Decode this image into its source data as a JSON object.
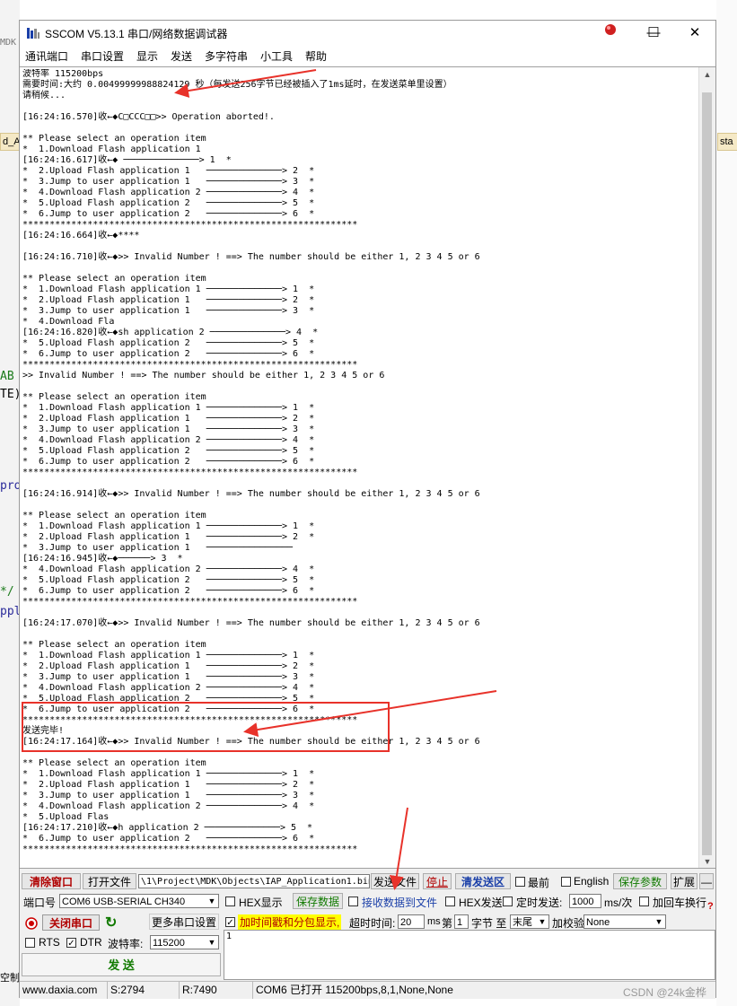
{
  "background": {
    "frag_mdk": "MDK",
    "frag_ab": "AB",
    "frag_te": "TE)",
    "frag_pro": "pro",
    "frag_comment": "*/",
    "frag_pl": "ppl",
    "frag_ctrl": "空制",
    "tab_left": "d_A",
    "tab_right": "sta"
  },
  "window": {
    "title": "SSCOM V5.13.1 串口/网络数据调试器",
    "minimize": "—",
    "maximize": "☐",
    "close": "✕"
  },
  "menu": [
    "通讯端口",
    "串口设置",
    "显示",
    "发送",
    "多字符串",
    "小工具",
    "帮助"
  ],
  "receive_lines": [
    "波特率 115200bps",
    "需要时间:大约 0.00499999988824129 秒（每发送256字节已经被插入了1ms延时，在发送菜单里设置）",
    "请稍候...",
    "",
    "[16:24:16.570]收←◆C□CCC□□>> Operation aborted!.",
    "",
    "** Please select an operation item",
    "*  1.Download Flash application 1",
    "[16:24:16.617]收←◆ ──────────────> 1  *",
    "*  2.Upload Flash application 1   ──────────────> 2  *",
    "*  3.Jump to user application 1   ──────────────> 3  *",
    "*  4.Download Flash application 2 ──────────────> 4  *",
    "*  5.Upload Flash application 2   ──────────────> 5  *",
    "*  6.Jump to user application 2   ──────────────> 6  *",
    "**************************************************************",
    "[16:24:16.664]收←◆****",
    "",
    "[16:24:16.710]收←◆>> Invalid Number ! ==> The number should be either 1, 2 3 4 5 or 6",
    "",
    "** Please select an operation item",
    "*  1.Download Flash application 1 ──────────────> 1  *",
    "*  2.Upload Flash application 1   ──────────────> 2  *",
    "*  3.Jump to user application 1   ──────────────> 3  *",
    "*  4.Download Fla",
    "[16:24:16.820]收←◆sh application 2 ──────────────> 4  *",
    "*  5.Upload Flash application 2   ──────────────> 5  *",
    "*  6.Jump to user application 2   ──────────────> 6  *",
    "**************************************************************",
    ">> Invalid Number ! ==> The number should be either 1, 2 3 4 5 or 6",
    "",
    "** Please select an operation item",
    "*  1.Download Flash application 1 ──────────────> 1  *",
    "*  2.Upload Flash application 1   ──────────────> 2  *",
    "*  3.Jump to user application 1   ──────────────> 3  *",
    "*  4.Download Flash application 2 ──────────────> 4  *",
    "*  5.Upload Flash application 2   ──────────────> 5  *",
    "*  6.Jump to user application 2   ──────────────> 6  *",
    "**************************************************************",
    "",
    "[16:24:16.914]收←◆>> Invalid Number ! ==> The number should be either 1, 2 3 4 5 or 6",
    "",
    "** Please select an operation item",
    "*  1.Download Flash application 1 ──────────────> 1  *",
    "*  2.Upload Flash application 1   ──────────────> 2  *",
    "*  3.Jump to user application 1   ────────────────",
    "[16:24:16.945]收←◆──────> 3  *",
    "*  4.Download Flash application 2 ──────────────> 4  *",
    "*  5.Upload Flash application 2   ──────────────> 5  *",
    "*  6.Jump to user application 2   ──────────────> 6  *",
    "**************************************************************",
    "",
    "[16:24:17.070]收←◆>> Invalid Number ! ==> The number should be either 1, 2 3 4 5 or 6",
    "",
    "** Please select an operation item",
    "*  1.Download Flash application 1 ──────────────> 1  *",
    "*  2.Upload Flash application 1   ──────────────> 2  *",
    "*  3.Jump to user application 1   ──────────────> 3  *",
    "*  4.Download Flash application 2 ──────────────> 4  *",
    "*  5.Upload Flash application 2   ──────────────> 5  *",
    "*  6.Jump to user application 2   ──────────────> 6  *",
    "**************************************************************",
    "发送完毕!",
    "[16:24:17.164]收←◆>> Invalid Number ! ==> The number should be either 1, 2 3 4 5 or 6",
    "",
    "** Please select an operation item",
    "*  1.Download Flash application 1 ──────────────> 1  *",
    "*  2.Upload Flash application 1   ──────────────> 2  *",
    "*  3.Jump to user application 1   ──────────────> 3  *",
    "*  4.Download Flash application 2 ──────────────> 4  *",
    "*  5.Upload Flas",
    "[16:24:17.210]收←◆h application 2 ──────────────> 5  *",
    "*  6.Jump to user application 2   ──────────────> 6  *",
    "**************************************************************"
  ],
  "controls": {
    "clear_window": "清除窗口",
    "open_file": "打开文件",
    "file_path": "\\1\\Project\\MDK\\Objects\\IAP_Application1.bin",
    "send_file": "发送文件",
    "stop": "停止",
    "clear_send": "清发送区",
    "topmost": "最前",
    "english": "English",
    "save_params": "保存参数",
    "expand": "扩展",
    "collapse": "—",
    "port_label": "端口号",
    "port_value": "COM6 USB-SERIAL CH340",
    "hex_display": "HEX显示",
    "save_data": "保存数据",
    "recv_to_file": "接收数据到文件",
    "hex_send": "HEX发送",
    "timed_send": "定时发送:",
    "interval_value": "1000",
    "interval_unit": "ms/次",
    "append_crlf": "加回车换行",
    "help_q": "?",
    "close_port": "关闭串口",
    "refresh": "↻",
    "more_settings": "更多串口设置",
    "timestamp_split": "加时间戳和分包显示,",
    "timeout_label": "超时时间:",
    "timeout_value": "20",
    "timeout_unit": "ms",
    "page_label": "第",
    "page_value": "1",
    "byte_label": "字节 至",
    "end_value": "末尾",
    "checksum_label": "加校验",
    "checksum_value": "None",
    "rts": "RTS",
    "dtr": "DTR",
    "baud_label": "波特率:",
    "baud_value": "115200",
    "send": "发  送",
    "send_content": "1"
  },
  "status": {
    "website": "www.daxia.com",
    "sent": "S:2794",
    "received": "R:7490",
    "port_status": "COM6 已打开  115200bps,8,1,None,None"
  },
  "watermark": "CSDN @24k金桦",
  "colors": {
    "annotation_red": "#e8322a",
    "highlight_yellow": "#ffff00",
    "close_red": "#b00000"
  }
}
